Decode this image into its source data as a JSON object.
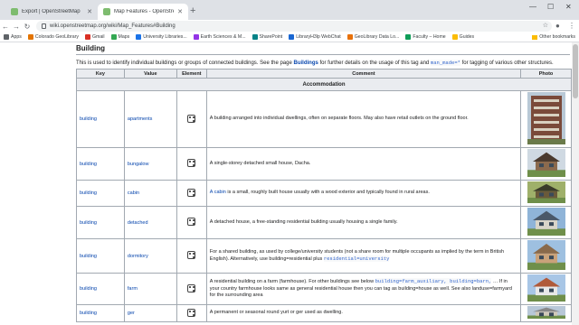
{
  "browser": {
    "tabs": [
      {
        "title": "Export | OpenStreetMap",
        "active": false
      },
      {
        "title": "Map Features - OpenStreetMap",
        "active": true
      }
    ],
    "new_tab_icon": "+",
    "url": "wiki.openstreetmap.org/wiki/Map_Features#Building",
    "bookmarks": [
      {
        "label": "Apps",
        "color": "#5f6368"
      },
      {
        "label": "Colorado GeoLibrary",
        "color": "#e37400"
      },
      {
        "label": "Gmail",
        "color": "#d93025"
      },
      {
        "label": "Maps",
        "color": "#34a853"
      },
      {
        "label": "University Libraries...",
        "color": "#1a73e8"
      },
      {
        "label": "Earth Sciences & M...",
        "color": "#9334e6"
      },
      {
        "label": "SharePoint",
        "color": "#038387"
      },
      {
        "label": "LibraryH3lp WebChat",
        "color": "#1967d2"
      },
      {
        "label": "GeoLibrary Data Lo...",
        "color": "#e8710a"
      },
      {
        "label": "Faculty – Home",
        "color": "#0f9d58"
      },
      {
        "label": "Guides",
        "color": "#fbbc04"
      }
    ],
    "other_bookmarks": "Other bookmarks"
  },
  "article": {
    "heading": "Building",
    "intro_before": "This is used to identify individual buildings or groups of connected buildings. See the page ",
    "intro_link": "Buildings",
    "intro_mid": " for further details on the usage of this tag and ",
    "intro_code": "man_made=*",
    "intro_after": " for tagging of various other structures."
  },
  "table": {
    "headers": {
      "key": "Key",
      "value": "Value",
      "element": "Element",
      "comment": "Comment",
      "photo": "Photo"
    },
    "section": "Accommodation",
    "rows": [
      {
        "key": "building",
        "value": "apartments",
        "comment": "A building arranged into individual dwellings, often on separate floors. May also have retail outlets on the ground floor."
      },
      {
        "key": "building",
        "value": "bungalow",
        "comment": "A single-storey detached small house, Dacha."
      },
      {
        "key": "building",
        "value": "cabin",
        "comment_link": "A cabin",
        "comment": " is a small, roughly built house usually with a wood exterior and typically found in rural areas."
      },
      {
        "key": "building",
        "value": "detached",
        "comment": "A detached house, a free-standing residential building usually housing a single family."
      },
      {
        "key": "building",
        "value": "dormitory",
        "comment": "For a shared building, as used by college/university students (not a share room for multiple occupants as implied by the term in British English). Alternatively, use building=residential plus ",
        "comment_code": "residential=university"
      },
      {
        "key": "building",
        "value": "farm",
        "comment": "A residential building on a farm (farmhouse). For other buildings see below ",
        "comment_code": "building=farm_auxiliary, building=barn,",
        "comment_tail": " … If in your country farmhouse looks same as general residential house then you can tag as building=house as well. See also landuse=farmyard for the surrounding area"
      },
      {
        "key": "building",
        "value": "ger",
        "comment": "A permanent or seasonal round yurt or ger used as dwelling."
      }
    ]
  }
}
